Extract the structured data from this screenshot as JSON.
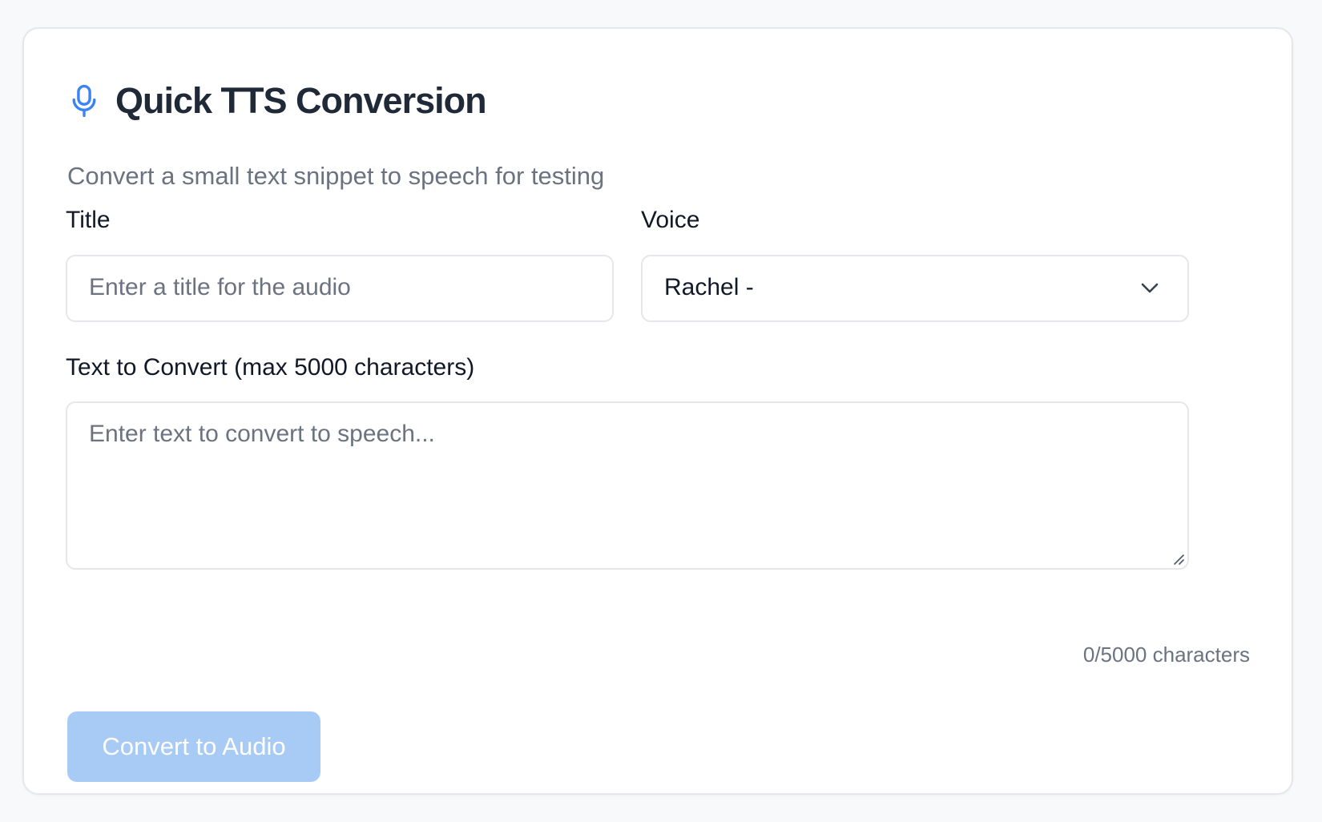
{
  "header": {
    "icon": "microphone-icon",
    "title": "Quick TTS Conversion",
    "subtitle": "Convert a small text snippet to speech for testing"
  },
  "form": {
    "title_field": {
      "label": "Title",
      "placeholder": "Enter a title for the audio",
      "value": ""
    },
    "voice_field": {
      "label": "Voice",
      "selected": "Rachel -"
    },
    "text_field": {
      "label": "Text to Convert (max 5000 characters)",
      "placeholder": "Enter text to convert to speech...",
      "value": ""
    },
    "counter": "0/5000 characters",
    "submit_label": "Convert to Audio",
    "submit_disabled": true
  },
  "colors": {
    "accent": "#3b82f6",
    "button_disabled": "#a8cbf5"
  }
}
